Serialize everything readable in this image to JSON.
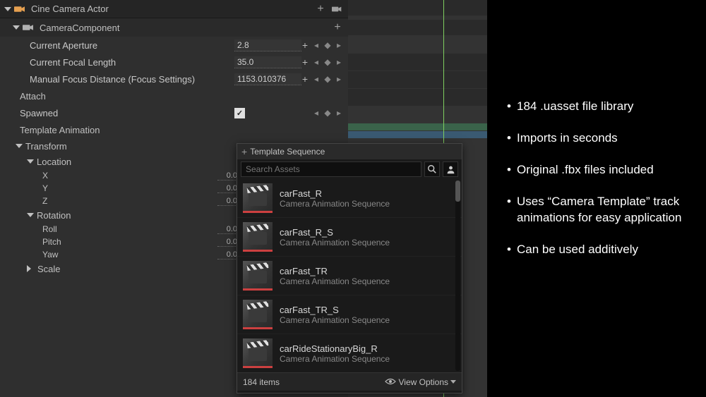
{
  "actor": {
    "title": "Cine Camera Actor"
  },
  "component": {
    "title": "CameraComponent"
  },
  "props": {
    "aperture": {
      "label": "Current Aperture",
      "value": "2.8"
    },
    "focal": {
      "label": "Current Focal Length",
      "value": "35.0"
    },
    "focus": {
      "label": "Manual Focus Distance (Focus Settings)",
      "value": "1153.010376"
    },
    "attach": {
      "label": "Attach"
    },
    "spawned": {
      "label": "Spawned"
    },
    "templateAnim": {
      "label": "Template Animation"
    }
  },
  "transform": {
    "title": "Transform",
    "location": {
      "title": "Location",
      "x": {
        "label": "X",
        "value": "0.0"
      },
      "y": {
        "label": "Y",
        "value": "0.0"
      },
      "z": {
        "label": "Z",
        "value": "0.0"
      }
    },
    "rotation": {
      "title": "Rotation",
      "roll": {
        "label": "Roll",
        "value": "0.0"
      },
      "pitch": {
        "label": "Pitch",
        "value": "0.0"
      },
      "yaw": {
        "label": "Yaw",
        "value": "0.0"
      }
    },
    "scale": {
      "title": "Scale"
    }
  },
  "picker": {
    "header": "Template Sequence",
    "search_placeholder": "Search Assets",
    "items_label": "184 items",
    "view_options": "View Options",
    "type_label": "Camera Animation Sequence",
    "assets": [
      {
        "name": "carFast_R"
      },
      {
        "name": "carFast_R_S"
      },
      {
        "name": "carFast_TR"
      },
      {
        "name": "carFast_TR_S"
      },
      {
        "name": "carRideStationaryBig_R"
      }
    ]
  },
  "info": {
    "bullets": [
      "184 .uasset file library",
      "Imports in seconds",
      "Original .fbx files included",
      "Uses “Camera Template” track animations for easy application",
      "Can be used additively"
    ]
  }
}
